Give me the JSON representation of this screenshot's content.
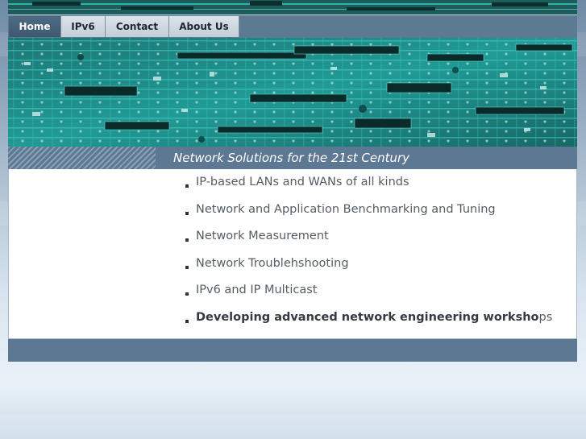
{
  "nav": {
    "items": [
      {
        "label": "Home",
        "active": true
      },
      {
        "label": "IPv6",
        "active": false
      },
      {
        "label": "Contact",
        "active": false
      },
      {
        "label": "About Us",
        "active": false
      }
    ]
  },
  "hero": {
    "image": "circuit-board-photo",
    "tint_color": "#1fc7c0"
  },
  "tagline": "Network Solutions for the 21st Century",
  "services": [
    "IP-based LANs and WANs of all kinds",
    "Network and Application Benchmarking and Tuning",
    "Network Measurement",
    "Network Troublehshooting",
    "IPv6 and IP Multicast"
  ],
  "last_service": {
    "bold": "Developing advanced network engineering worksho",
    "rest": "ps"
  },
  "colors": {
    "nav_active": "#4f6b84",
    "bar": "#5c7892",
    "text": "#555c63"
  }
}
